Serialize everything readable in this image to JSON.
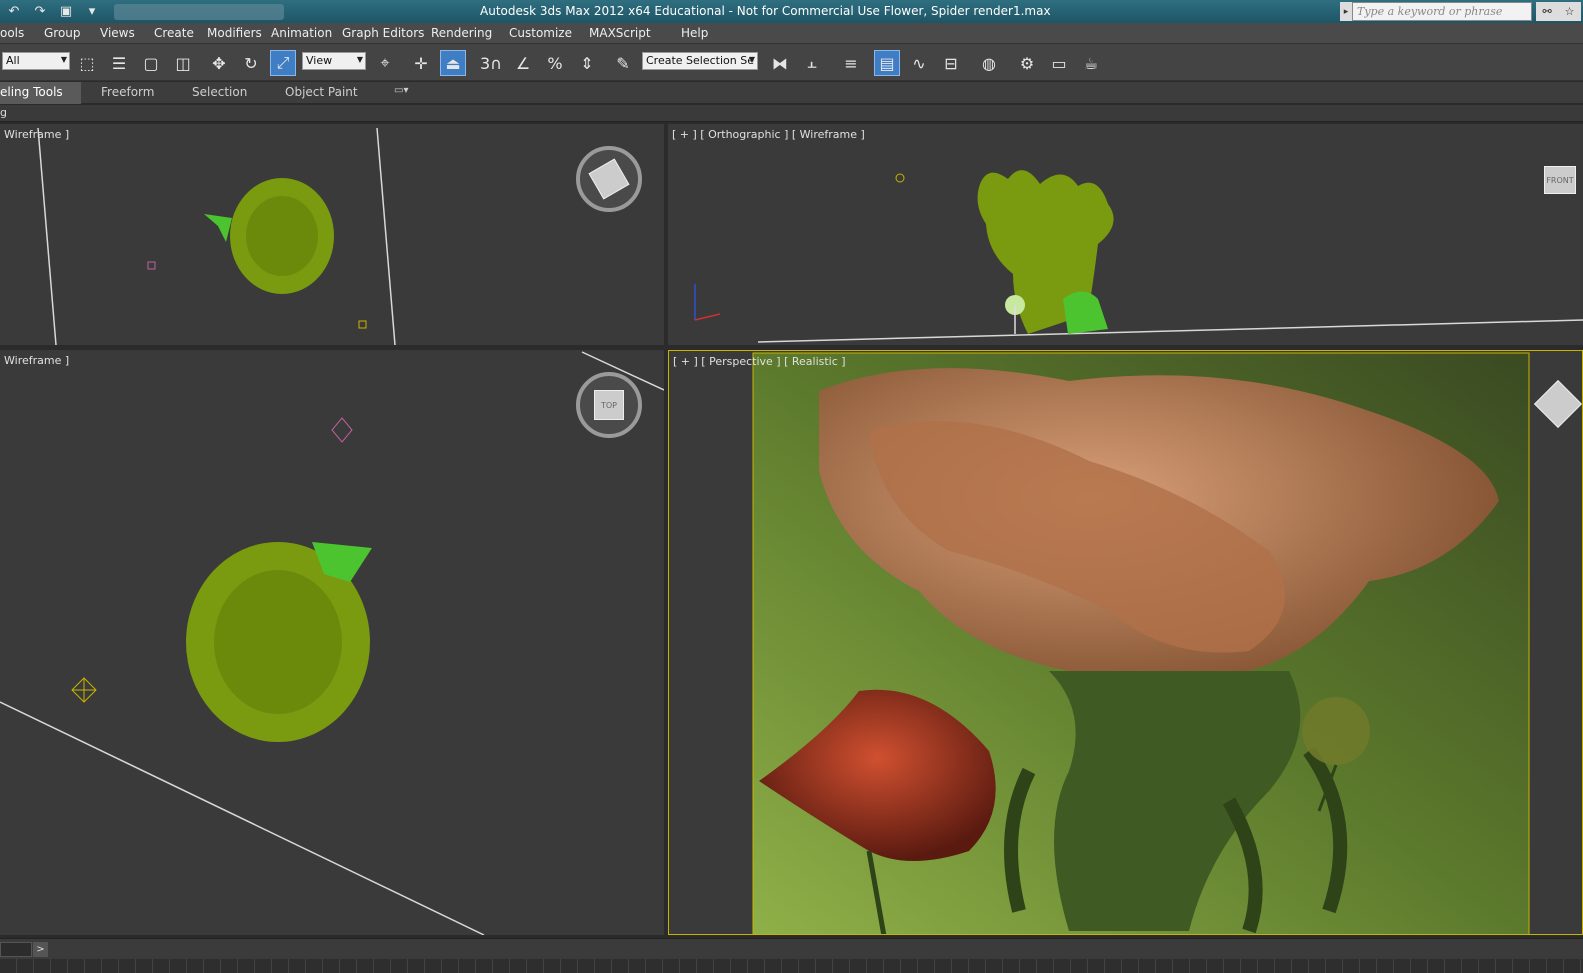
{
  "titlebar": {
    "title": "Autodesk 3ds Max  2012 x64    Educational - Not for Commercial Use     Flower, Spider render1.max",
    "search_placeholder": "Type a keyword or phrase",
    "quick_access_icons": [
      "undo-icon",
      "redo-icon",
      "project-folder-icon",
      "dropdown-icon"
    ]
  },
  "menubar": {
    "items": [
      {
        "label": "ools"
      },
      {
        "label": "Group"
      },
      {
        "label": "Views"
      },
      {
        "label": "Create"
      },
      {
        "label": "Modifiers"
      },
      {
        "label": "Animation"
      },
      {
        "label": "Graph Editors"
      },
      {
        "label": "Rendering"
      },
      {
        "label": "Customize"
      },
      {
        "label": "MAXScript"
      },
      {
        "label": "Help"
      }
    ]
  },
  "toolbar": {
    "selection_filter": "All",
    "reference_coord": "View",
    "named_selection": "Create Selection Se",
    "snap_label": "3"
  },
  "ribbon": {
    "tabs": [
      "eling Tools",
      "Freeform",
      "Selection",
      "Object Paint"
    ],
    "sub_label": "g"
  },
  "viewports": {
    "top_left": {
      "label": "Wireframe ]"
    },
    "top_right": {
      "label": "[ + ] [ Orthographic ] [ Wireframe ]",
      "cube_label": "FRONT"
    },
    "bottom_left": {
      "label": "Wireframe ]",
      "cube_label": "TOP"
    },
    "bottom_right": {
      "label": "[ + ] [ Perspective ] [ Realistic ]"
    }
  },
  "statusbar": {
    "arrow": ">"
  },
  "colors": {
    "title_bg": "#1d5566",
    "active_tool": "#3f7ec4",
    "flower_wire": "#7a9a10",
    "spider_green": "#4cc430",
    "viewport_active_border": "#c8b400"
  }
}
